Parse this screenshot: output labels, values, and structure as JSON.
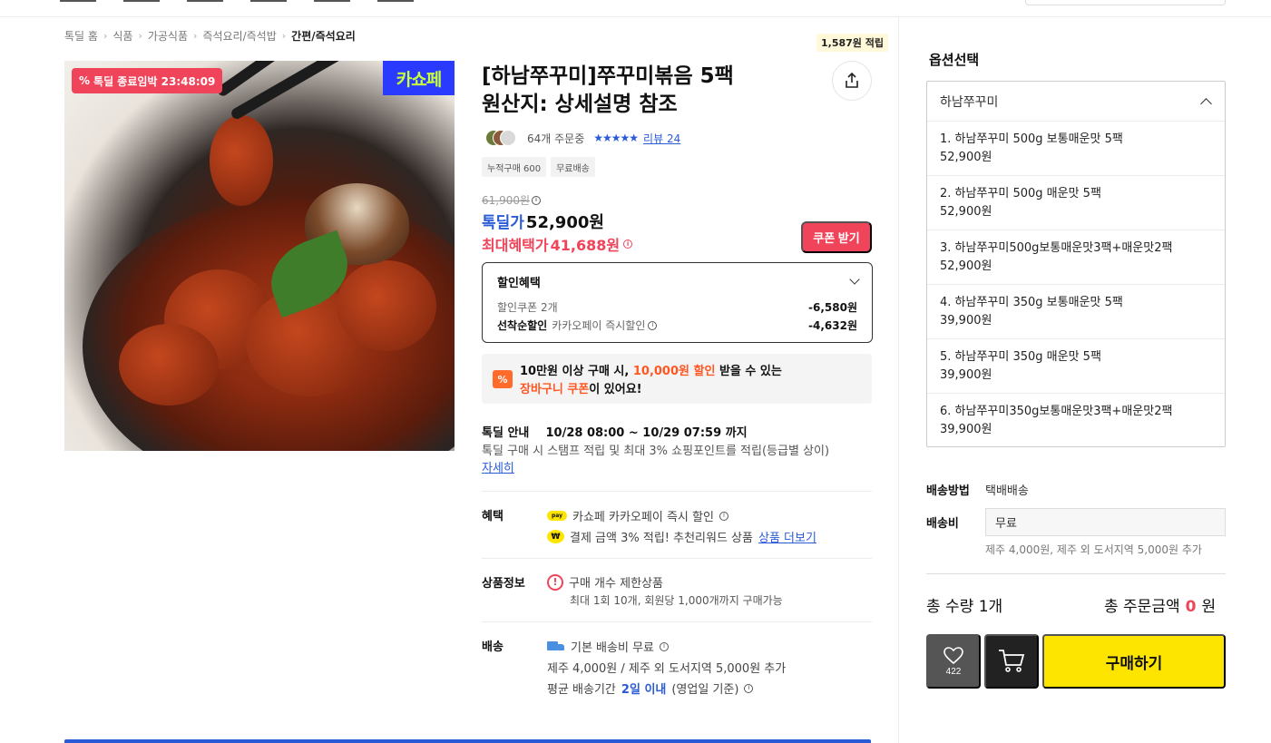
{
  "breadcrumb": [
    "톡딜 홈",
    "식품",
    "가공식품",
    "즉석요리/즉석밥",
    "간편/즉석요리"
  ],
  "image_badges": {
    "timer_label": "톡딜 종료임박 23:48:09",
    "store_label": "카쇼페"
  },
  "points_badge": "1,587원 적립",
  "product": {
    "title_line1": "[하남쭈꾸미]쭈꾸미볶음 5팩",
    "title_line2": "원산지: 상세설명 참조",
    "order_count": "64개 주문중",
    "rating_stars": "★★★★★",
    "review_label": "리뷰 24",
    "tags": [
      "누적구매 600",
      "무료배송"
    ]
  },
  "price": {
    "original": "61,900원",
    "deal_label": "톡딜가",
    "deal_value": "52,900원",
    "max_label": "최대혜택가",
    "max_value": "41,688원",
    "coupon_button": "쿠폰 받기"
  },
  "discount": {
    "heading": "할인혜택",
    "rows": [
      {
        "label_bold": "",
        "label": "할인쿠폰 2개",
        "value": "-6,580원"
      },
      {
        "label_bold": "선착순할인",
        "label": "카카오페이 즉시할인",
        "value": "-4,632원"
      }
    ]
  },
  "cart_banner": {
    "icon": "%",
    "line1_a": "10만원 이상 구매 시, ",
    "line1_hl": "10,000원 할인",
    "line1_b": " 받을 수 있는",
    "line2_hl": "장바구니 쿠폰",
    "line2_b": "이 있어요!"
  },
  "deal_info": {
    "label": "톡딜 안내",
    "period": "10/28 08:00 ~ 10/29 07:59 까지",
    "desc": "톡딜 구매 시 스탬프 적립 및 최대 3% 쇼핑포인트를 적립(등급별 상이)",
    "more_link": "자세히"
  },
  "benefit": {
    "label": "혜택",
    "pay_badge": "pay",
    "line1": "카쇼페 카카오페이 즉시 할인",
    "won_badge": "₩",
    "line2": "결제 금액 3% 적립! 추천리워드 상품",
    "line2_link": "상품 더보기"
  },
  "product_info": {
    "label": "상품정보",
    "alert_icon": "!",
    "line1": "구매 개수 제한상품",
    "line2": "최대 1회 10개, 회원당 1,000개까지 구매가능"
  },
  "delivery": {
    "label": "배송",
    "line1": "기본 배송비 무료",
    "line2": "제주 4,000원 / 제주 외 도서지역 5,000원 추가",
    "line3_a": "평균 배송기간",
    "line3_hl": "2일 이내",
    "line3_b": "(영업일 기준)"
  },
  "options": {
    "title": "옵션선택",
    "selected": "하남쭈꾸미",
    "items": [
      {
        "name": "1. 하남쭈꾸미 500g 보통매운맛 5팩",
        "price": "52,900원"
      },
      {
        "name": "2. 하남쭈꾸미 500g 매운맛 5팩",
        "price": "52,900원"
      },
      {
        "name": "3. 하남쭈꾸미500g보통매운맛3팩+매운맛2팩",
        "price": "52,900원"
      },
      {
        "name": "4. 하남쭈꾸미 350g 보통매운맛 5팩",
        "price": "39,900원"
      },
      {
        "name": "5. 하남쭈꾸미 350g 매운맛 5팩",
        "price": "39,900원"
      },
      {
        "name": "6. 하남쭈꾸미350g보통매운맛3팩+매운맛2팩",
        "price": "39,900원"
      }
    ]
  },
  "shipping": {
    "method_label": "배송방법",
    "method_value": "택배배송",
    "fee_label": "배송비",
    "fee_value": "무료",
    "fee_note": "제주 4,000원, 제주 외 도서지역 5,000원 추가"
  },
  "totals": {
    "qty": "총 수량 1개",
    "amount_label": "총 주문금액",
    "amount_value": "0",
    "amount_unit": "원"
  },
  "actions": {
    "like_count": "422",
    "buy_label": "구매하기"
  },
  "colors": {
    "accent_red": "#f0445a",
    "accent_blue": "#2a5bd7",
    "kakao_yellow": "#fee500"
  }
}
